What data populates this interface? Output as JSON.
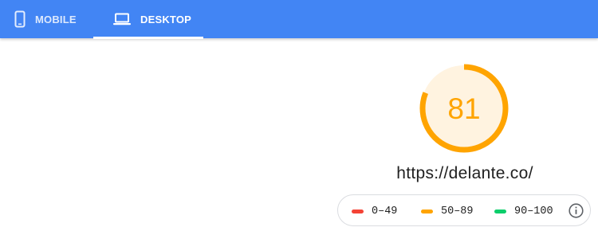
{
  "tabs": [
    {
      "label": "MOBILE",
      "icon": "smartphone-icon",
      "active": false
    },
    {
      "label": "DESKTOP",
      "icon": "laptop-icon",
      "active": true
    }
  ],
  "colors": {
    "tabbar": "#4285f4",
    "score_orange": "#ffa400",
    "score_orange_fill": "#fff3e0",
    "legend_red": "#f44336",
    "legend_orange": "#ffa400",
    "legend_green": "#0cce6b"
  },
  "score": {
    "value": "81",
    "progress": 0.81
  },
  "url": "https://delante.co/",
  "legend": {
    "ranges": [
      {
        "label": "0–49",
        "color": "#f44336"
      },
      {
        "label": "50–89",
        "color": "#ffa400"
      },
      {
        "label": "90–100",
        "color": "#0cce6b"
      }
    ],
    "info_icon": "info-icon"
  }
}
